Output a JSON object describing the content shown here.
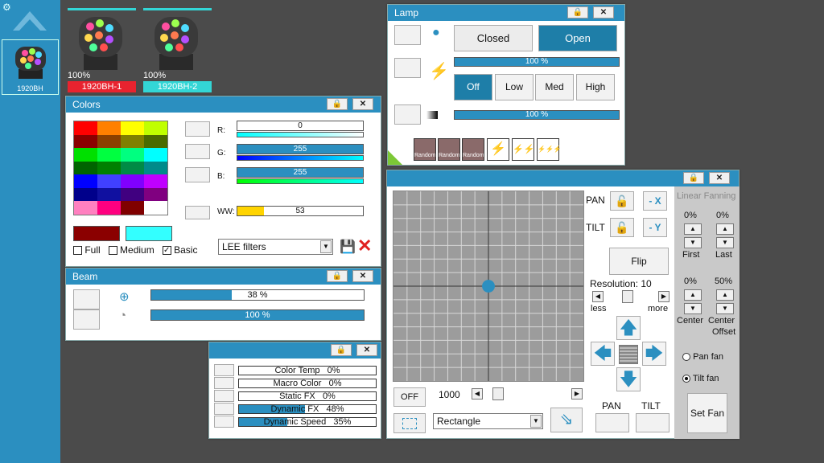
{
  "fixtures": {
    "group_label": "1920BH",
    "items": [
      {
        "percent": "100%",
        "name": "1920BH-1",
        "color": "#e8232f"
      },
      {
        "percent": "100%",
        "name": "1920BH-2",
        "color": "#33d6d6"
      }
    ]
  },
  "colors_win": {
    "title": "Colors",
    "r_label": "R:",
    "g_label": "G:",
    "b_label": "B:",
    "ww_label": "WW:",
    "r_value": "0",
    "g_value": "255",
    "b_value": "255",
    "ww_value": "53",
    "full": "Full",
    "medium": "Medium",
    "basic": "Basic",
    "filter_selected": "LEE filters",
    "swatches": [
      "#ff0000",
      "#ff8000",
      "#ffff00",
      "#c0ff00",
      "#8b0000",
      "#8b4000",
      "#808000",
      "#4a6b00",
      "#00e000",
      "#00ff40",
      "#00ff80",
      "#00ffff",
      "#006400",
      "#008000",
      "#008b45",
      "#008b8b",
      "#0000ff",
      "#4040ff",
      "#8000ff",
      "#c000ff",
      "#00008b",
      "#1010a0",
      "#400080",
      "#800080",
      "#ff80c0",
      "#ff0080",
      "#800000",
      "#ffffff"
    ]
  },
  "beam_win": {
    "title": "Beam",
    "zoom_value": "38 %",
    "zoom_level": 38,
    "focus_value": "100 %",
    "focus_level": 100
  },
  "fx_win": {
    "items": [
      {
        "label": "Color Temp",
        "value": "0%",
        "level": 0
      },
      {
        "label": "Macro Color",
        "value": "0%",
        "level": 0
      },
      {
        "label": "Static FX",
        "value": "0%",
        "level": 0
      },
      {
        "label": "Dynamic FX",
        "value": "48%",
        "level": 48
      },
      {
        "label": "Dynamic Speed",
        "value": "35%",
        "level": 35
      }
    ]
  },
  "lamp_win": {
    "title": "Lamp",
    "closed": "Closed",
    "open": "Open",
    "strobe_value": "100 %",
    "strobe_level": 100,
    "off": "Off",
    "low": "Low",
    "med": "Med",
    "high": "High",
    "dimmer_value": "100 %",
    "dimmer_level": 100,
    "random": "Random"
  },
  "pantilt_win": {
    "pan": "PAN",
    "tilt": "TILT",
    "minus_x": "- X",
    "minus_y": "- Y",
    "flip": "Flip",
    "resolution": "Resolution: 10",
    "less": "less",
    "more": "more",
    "off": "OFF",
    "speed_value": "1000",
    "shape_selected": "Rectangle",
    "pan_bottom": "PAN",
    "tilt_bottom": "TILT",
    "linear_fanning": "Linear Fanning",
    "first_value": "0%",
    "last_value": "0%",
    "first": "First",
    "last": "Last",
    "center_value": "0%",
    "center_offset_value": "50%",
    "center": "Center",
    "center_offset_1": "Center",
    "center_offset_2": "Offset",
    "pan_fan": "Pan fan",
    "tilt_fan": "Tilt fan",
    "set_fan": "Set Fan"
  },
  "icons": {
    "lock": "lock-icon",
    "close": "close-icon"
  }
}
